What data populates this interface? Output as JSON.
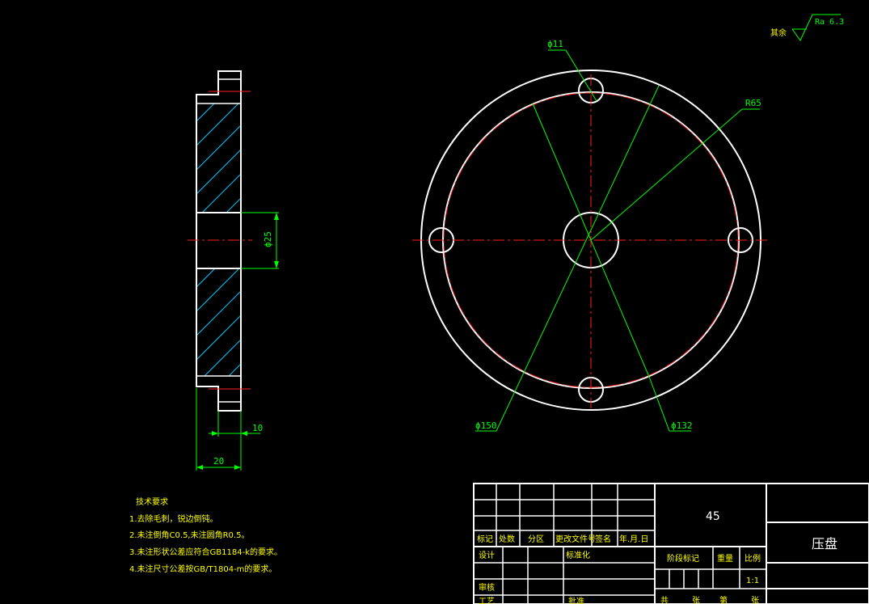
{
  "dimensions": {
    "hole_dia": "ϕ11",
    "radius": "R65",
    "outer_dia": "ϕ150",
    "pcd_dia": "ϕ132",
    "bore_dia": "ϕ25",
    "width_small": "10",
    "width_total": "20"
  },
  "roughness": {
    "prefix": "其余",
    "value": "Ra 6.3"
  },
  "tech_requirements": {
    "title": "技术要求",
    "items": [
      "1.去除毛刺，锐边倒钝。",
      "2.未注倒角C0.5,未注圆角R0.5。",
      "3.未注形状公差应符合GB1184-k的要求。",
      "4.未注尺寸公差按GB/T1804-m的要求。"
    ]
  },
  "title_block": {
    "material": "45",
    "part_name": "压盘",
    "headers": [
      "标记",
      "处数",
      "分区",
      "更改文件号",
      "签名",
      "年.月.日"
    ],
    "design": "设计",
    "standardize": "标准化",
    "stage_mark": "阶段标记",
    "weight": "重量",
    "scale": "比例",
    "review": "审核",
    "process": "工艺",
    "approve": "批准",
    "scale_value": "1:1",
    "total": "共",
    "sheet": "张",
    "page": "第",
    "sheet2": "张"
  },
  "colors": {
    "background": "#000000",
    "outline": "#ffffff",
    "dimension": "#00ff00",
    "centerline": "#ff2020",
    "hatch": "#00c8ff",
    "note": "#ffff00"
  }
}
